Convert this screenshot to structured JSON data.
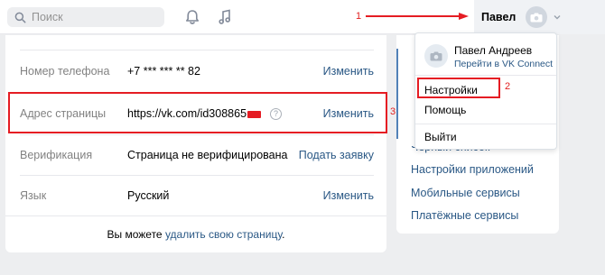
{
  "header": {
    "search_placeholder": "Поиск",
    "user_name": "Павел"
  },
  "annotations": {
    "n1": "1",
    "n2": "2",
    "n3": "3"
  },
  "settings": {
    "rows": [
      {
        "label": "Номер телефона",
        "value": "+7 *** *** ** 82",
        "action": "Изменить"
      },
      {
        "label": "Адрес страницы",
        "value": "https://vk.com/id308865",
        "action": "Изменить"
      },
      {
        "label": "Верификация",
        "value": "Страница не верифицирована",
        "action": "Подать заявку"
      },
      {
        "label": "Язык",
        "value": "Русский",
        "action": "Изменить"
      }
    ],
    "help_mark": "?",
    "footer_prefix": "Вы можете ",
    "footer_link": "удалить свою страницу",
    "footer_suffix": "."
  },
  "right_menu": {
    "partial_item": "Черный список",
    "items": [
      "Настройки приложений",
      "Мобильные сервисы",
      "Платёжные сервисы"
    ]
  },
  "dropdown": {
    "name": "Павел Андреев",
    "vk_connect": "Перейти в VK Connect",
    "items": [
      "Настройки",
      "Помощь",
      "Выйти"
    ]
  },
  "colors": {
    "link": "#2a5885",
    "annotation_red": "#e51c23",
    "background": "#edeef0"
  }
}
